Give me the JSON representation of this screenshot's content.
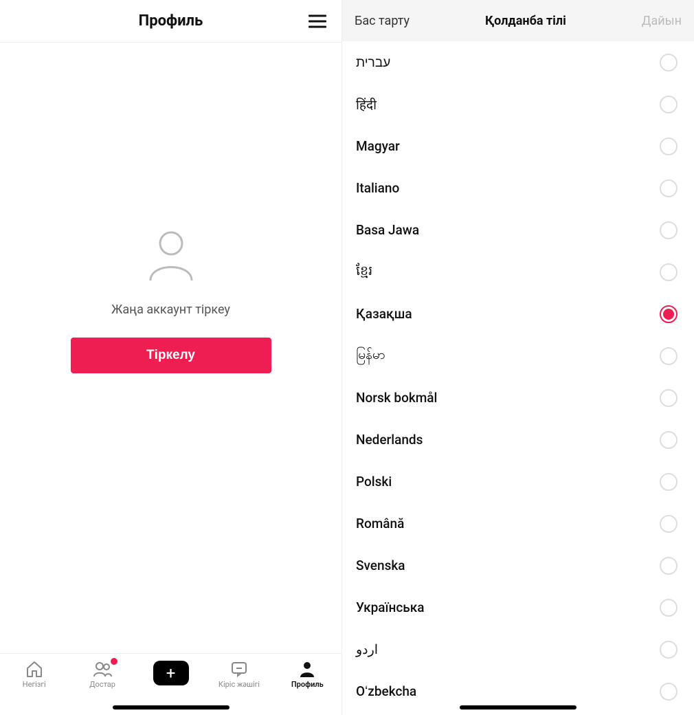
{
  "left": {
    "header_title": "Профиль",
    "signup_prompt": "Жаңа аккаунт тіркеу",
    "signup_button": "Тіркелу",
    "tabs": [
      {
        "id": "home",
        "label": "Негізгі",
        "active": false,
        "badge": false
      },
      {
        "id": "friends",
        "label": "Достар",
        "active": false,
        "badge": true
      },
      {
        "id": "create",
        "label": "",
        "active": false,
        "badge": false
      },
      {
        "id": "inbox",
        "label": "Кіріс жәшігі",
        "active": false,
        "badge": false
      },
      {
        "id": "profile",
        "label": "Профиль",
        "active": true,
        "badge": false
      }
    ]
  },
  "right": {
    "cancel": "Бас тарту",
    "title": "Қолданба тілі",
    "done": "Дайын",
    "languages": [
      {
        "label": "עברית",
        "selected": false
      },
      {
        "label": "हिंदी",
        "selected": false
      },
      {
        "label": "Magyar",
        "selected": false
      },
      {
        "label": "Italiano",
        "selected": false
      },
      {
        "label": "Basa Jawa",
        "selected": false
      },
      {
        "label": "ខ្មែរ",
        "selected": false
      },
      {
        "label": "Қазақша",
        "selected": true
      },
      {
        "label": "မြန်မာ",
        "selected": false
      },
      {
        "label": "Norsk bokmål",
        "selected": false
      },
      {
        "label": "Nederlands",
        "selected": false
      },
      {
        "label": "Polski",
        "selected": false
      },
      {
        "label": "Română",
        "selected": false
      },
      {
        "label": "Svenska",
        "selected": false
      },
      {
        "label": "Українська",
        "selected": false
      },
      {
        "label": "اردو",
        "selected": false
      },
      {
        "label": "Oʻzbekcha",
        "selected": false
      }
    ]
  }
}
